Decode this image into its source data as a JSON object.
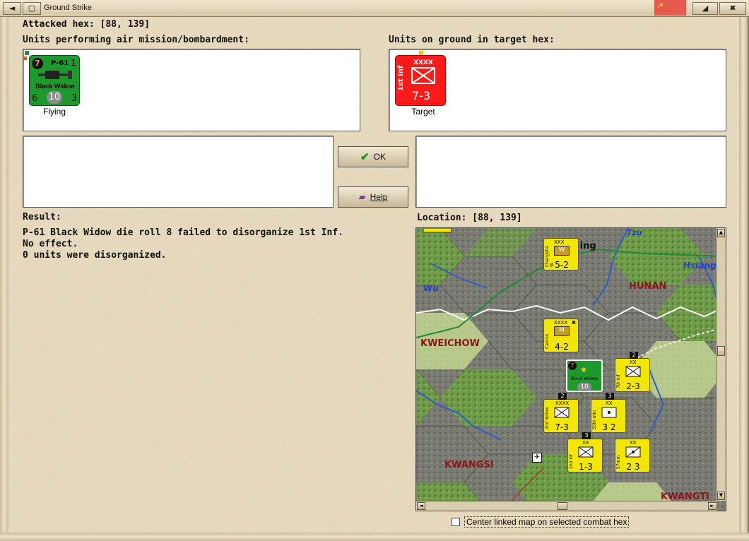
{
  "window": {
    "title": "Ground Strike"
  },
  "attacked_hex": "Attacked hex:  [88, 139]",
  "air_units_label": "Units performing air mission/bombardment:",
  "ground_units_label": "Units on ground in target hex:",
  "air_unit": {
    "type_label": "P-61",
    "name": "Black Widow",
    "badge": "7",
    "top_right": "1",
    "left_num": "6",
    "center_num": "10",
    "right_num": "3",
    "status": "Flying",
    "color": "#1c9a2c"
  },
  "ground_unit": {
    "side_name": "1st Inf",
    "size": "XXXX",
    "strength": "7-3",
    "status": "Target",
    "color": "#ff1a1a"
  },
  "buttons": {
    "ok": "OK",
    "help": "Help"
  },
  "result": {
    "label": "Result:",
    "lines": [
      "P-61 Black Widow die roll 8 failed to disorganize 1st Inf.",
      "No effect.",
      "0 units were disorganized."
    ]
  },
  "location": "Location:  [88, 139]",
  "map": {
    "regions": [
      "HUNAN",
      "KWEICHOW",
      "KWANGSI",
      "KWANGTI"
    ],
    "rivers": [
      "Wu",
      "Hsiang",
      "Tzu"
    ],
    "city_partial": "C    ing",
    "units": [
      {
        "side": "Changsha W.",
        "size": "XXX",
        "strength": "5-2",
        "type": "W",
        "color": "#f3e600"
      },
      {
        "side": "Canton",
        "size": "XXXX",
        "strength": "4-2",
        "type": "M",
        "color": "#f3e600",
        "tag": "R"
      },
      {
        "side": "Black Widow",
        "strength": "10",
        "color": "#1c9a2c",
        "badge": "7"
      },
      {
        "side": "7th Inf",
        "size": "XX",
        "strength": "2-3",
        "color": "#f3e600",
        "stack": "2"
      },
      {
        "side": "2nd Yellow",
        "size": "XXXX",
        "strength": "7-3",
        "color": "#f3e600",
        "stack": "2"
      },
      {
        "side": "55th mtn",
        "size": "XX",
        "strength": "3 2",
        "color": "#f3e600",
        "stack": "3"
      },
      {
        "side": "2nd inf",
        "size": "XX",
        "strength": "1-3",
        "color": "#f3e600",
        "stack": "3"
      },
      {
        "side": "57mm",
        "size": "XX",
        "strength": "2 3",
        "color": "#f3e600"
      }
    ]
  },
  "center_map_label": "Center linked map on selected combat hex"
}
